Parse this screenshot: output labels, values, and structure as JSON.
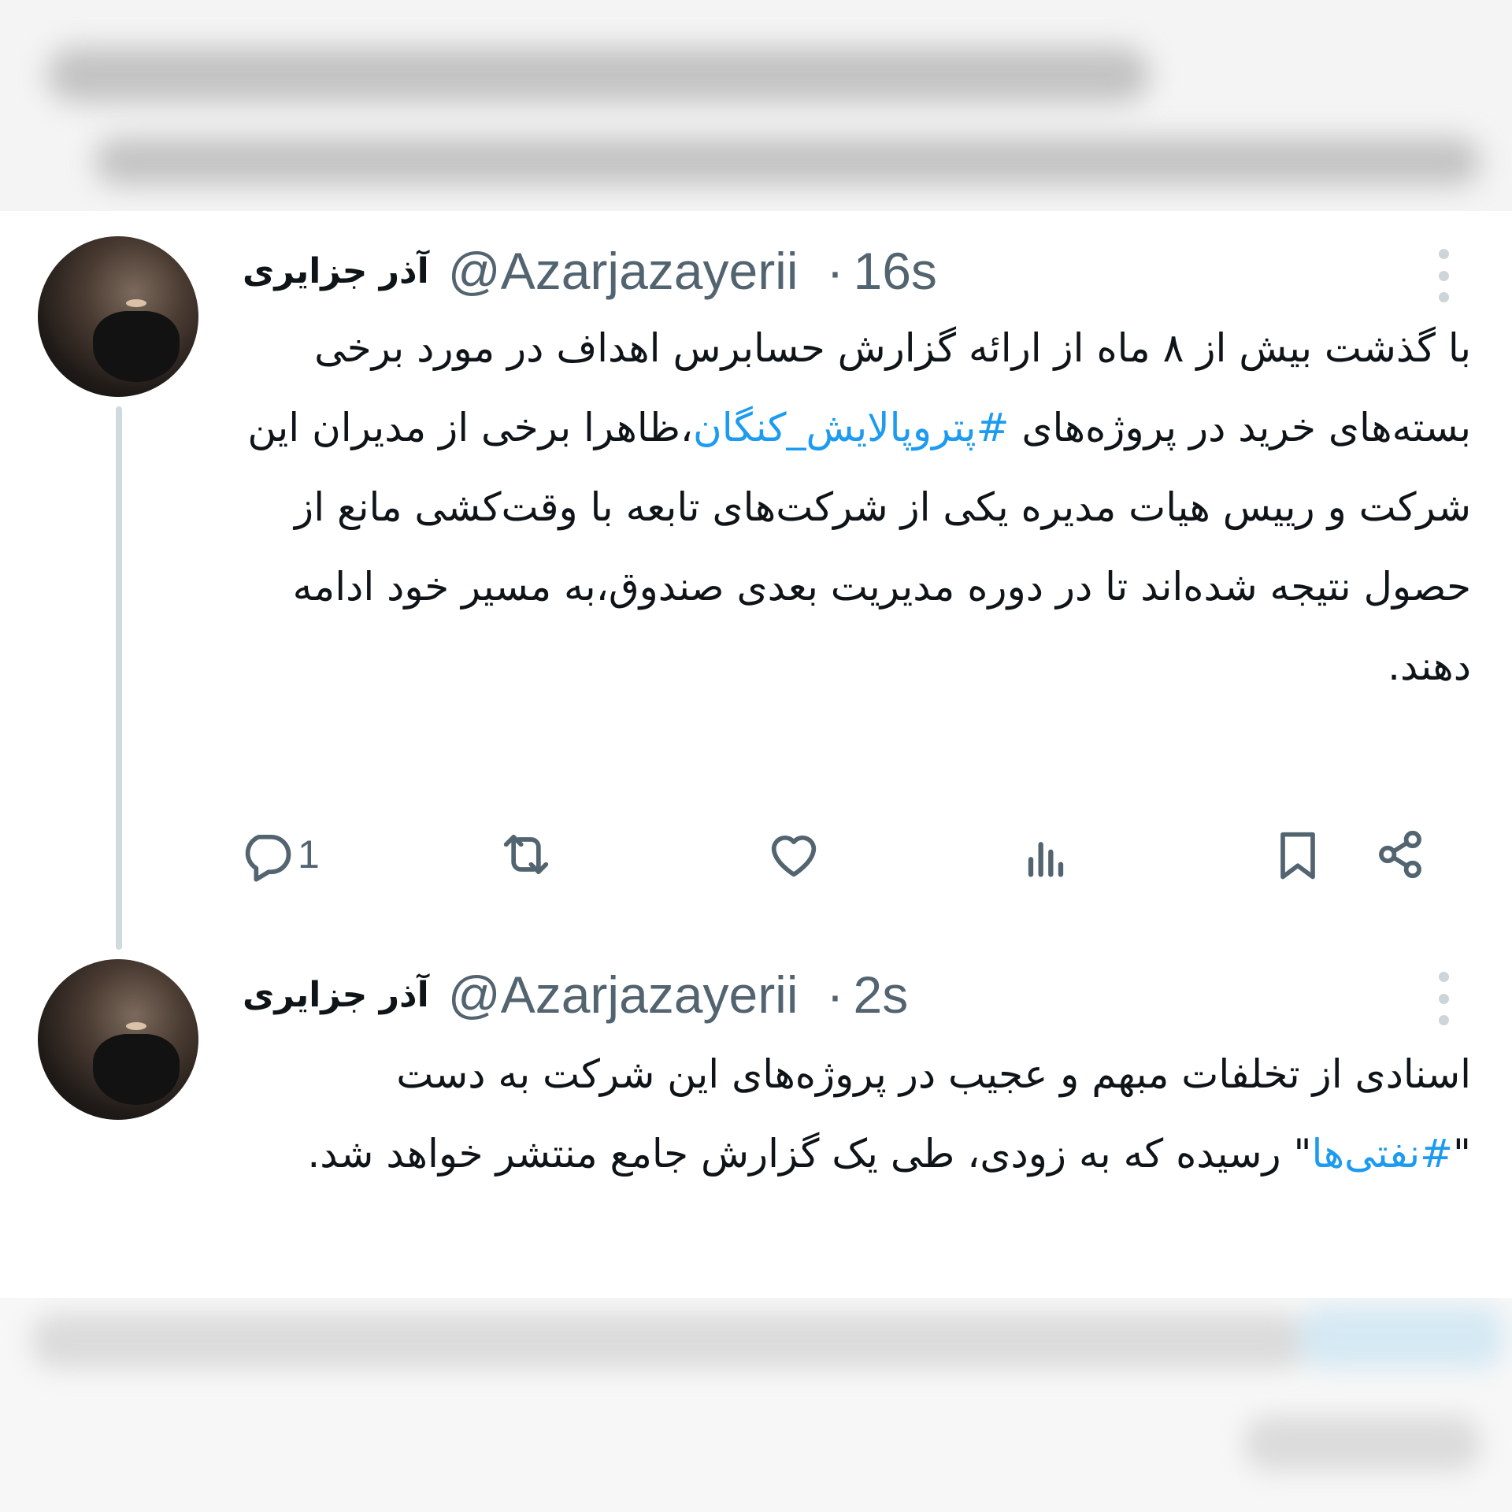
{
  "tweets": [
    {
      "display_name": "آذر جزایری",
      "handle": "@Azarjazayerii",
      "separator": "·",
      "time": "16s",
      "text_parts": [
        "با گذشت بیش از ۸ ماه از ارائه گزارش حسابرس اهداف در مورد برخی بسته‌های خرید در پروژه‌های ",
        "#پتروپالایش_کنگان",
        "،ظاهرا برخی از مدیران این شرکت و رییس هیات مدیره یکی از شرکت‌های تابعه با وقت‌کشی مانع از حصول نتیجه شده‌اند تا در دوره مدیریت بعدی صندوق،به مسیر خود ادامه دهند."
      ],
      "actions": {
        "reply_count": "1",
        "icons": [
          "reply-icon",
          "retweet-icon",
          "like-icon",
          "views-icon",
          "bookmark-icon",
          "share-icon"
        ]
      }
    },
    {
      "display_name": "آذر جزایری",
      "handle": "@Azarjazayerii",
      "separator": "·",
      "time": "2s",
      "text_parts": [
        "اسنادی از تخلفات مبهم و عجیب در پروژه‌های این شرکت به دست \"",
        "#نفتی‌ها",
        "\" رسیده که به زودی، طی یک گزارش جامع منتشر خواهد شد."
      ]
    }
  ],
  "colors": {
    "link": "#1d9bf0",
    "muted": "#536471",
    "text": "#0f1419",
    "thread_line": "#cfd9de"
  }
}
